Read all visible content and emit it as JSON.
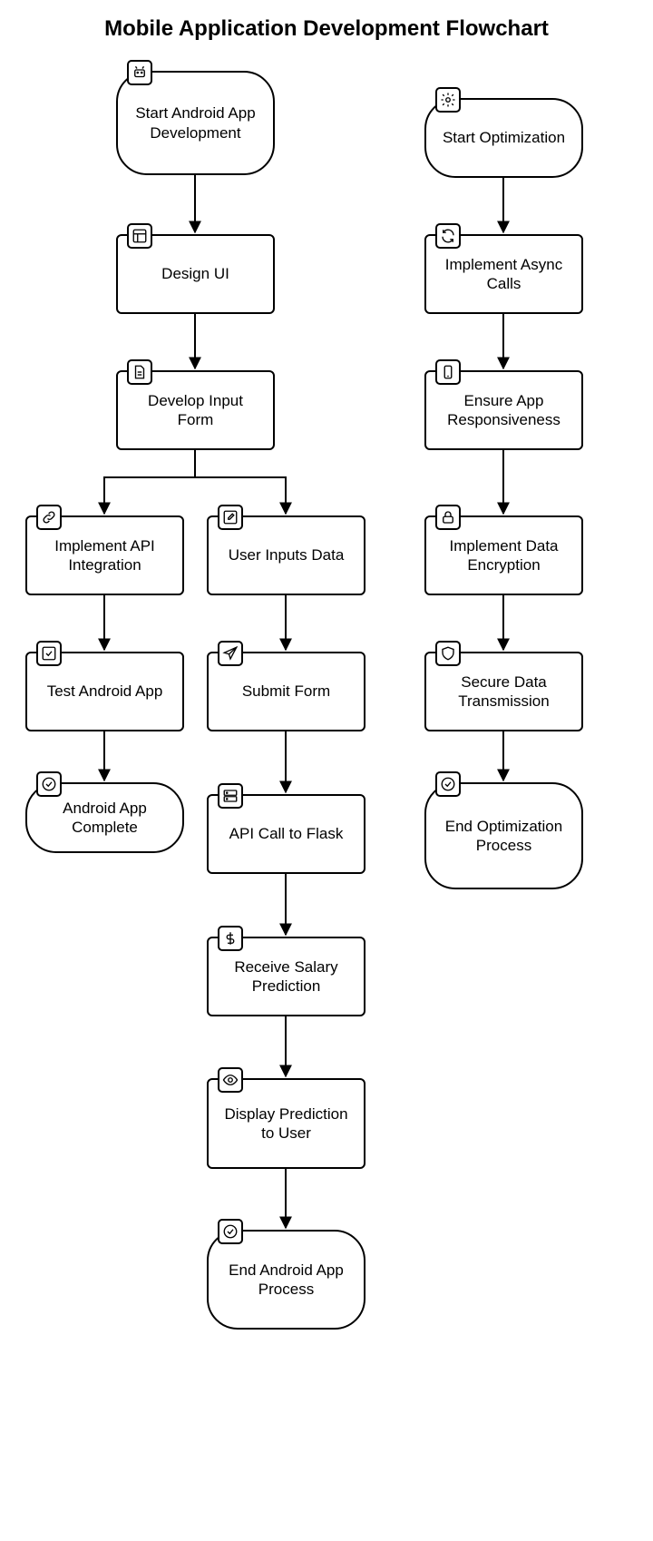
{
  "title": "Mobile Application Development Flowchart",
  "chart_data": {
    "type": "flowchart",
    "nodes": [
      {
        "id": "n1",
        "label": "Start Android App Development",
        "shape": "terminal",
        "icon": "android-icon"
      },
      {
        "id": "n2",
        "label": "Design UI",
        "shape": "rect",
        "icon": "layout-icon"
      },
      {
        "id": "n3",
        "label": "Develop Input Form",
        "shape": "rect",
        "icon": "document-icon"
      },
      {
        "id": "n4",
        "label": "Implement API Integration",
        "shape": "rect",
        "icon": "link-icon"
      },
      {
        "id": "n5",
        "label": "Test Android App",
        "shape": "rect",
        "icon": "check-square-icon"
      },
      {
        "id": "n6",
        "label": "Android App Complete",
        "shape": "terminal",
        "icon": "check-circle-icon"
      },
      {
        "id": "n7",
        "label": "User Inputs Data",
        "shape": "rect",
        "icon": "edit-icon"
      },
      {
        "id": "n8",
        "label": "Submit Form",
        "shape": "rect",
        "icon": "send-icon"
      },
      {
        "id": "n9",
        "label": "API Call to Flask",
        "shape": "rect",
        "icon": "server-icon"
      },
      {
        "id": "n10",
        "label": "Receive Salary Prediction",
        "shape": "rect",
        "icon": "dollar-icon"
      },
      {
        "id": "n11",
        "label": "Display Prediction to User",
        "shape": "rect",
        "icon": "eye-icon"
      },
      {
        "id": "n12",
        "label": "End Android App Process",
        "shape": "terminal",
        "icon": "check-circle-icon"
      },
      {
        "id": "n13",
        "label": "Start Optimization",
        "shape": "terminal",
        "icon": "gear-icon"
      },
      {
        "id": "n14",
        "label": "Implement Async Calls",
        "shape": "rect",
        "icon": "refresh-icon"
      },
      {
        "id": "n15",
        "label": "Ensure App Responsiveness",
        "shape": "rect",
        "icon": "phone-icon"
      },
      {
        "id": "n16",
        "label": "Implement Data Encryption",
        "shape": "rect",
        "icon": "lock-icon"
      },
      {
        "id": "n17",
        "label": "Secure Data Transmission",
        "shape": "rect",
        "icon": "shield-icon"
      },
      {
        "id": "n18",
        "label": "End Optimization Process",
        "shape": "terminal",
        "icon": "check-circle-icon"
      }
    ],
    "edges": [
      {
        "from": "n1",
        "to": "n2"
      },
      {
        "from": "n2",
        "to": "n3"
      },
      {
        "from": "n3",
        "to": "n4"
      },
      {
        "from": "n3",
        "to": "n7"
      },
      {
        "from": "n4",
        "to": "n5"
      },
      {
        "from": "n5",
        "to": "n6"
      },
      {
        "from": "n7",
        "to": "n8"
      },
      {
        "from": "n8",
        "to": "n9"
      },
      {
        "from": "n9",
        "to": "n10"
      },
      {
        "from": "n10",
        "to": "n11"
      },
      {
        "from": "n11",
        "to": "n12"
      },
      {
        "from": "n13",
        "to": "n14"
      },
      {
        "from": "n14",
        "to": "n15"
      },
      {
        "from": "n15",
        "to": "n16"
      },
      {
        "from": "n16",
        "to": "n17"
      },
      {
        "from": "n17",
        "to": "n18"
      }
    ]
  }
}
